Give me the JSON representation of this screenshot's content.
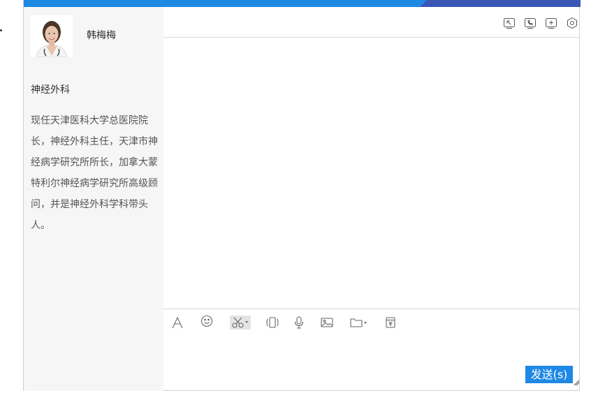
{
  "doctor": {
    "name": "韩梅梅",
    "department": "神经外科",
    "bio": "现任天津医科大学总医院院长，神经外科主任，天津市神经病学研究所所长，加拿大蒙特利尔神经病学研究所高级顾问，并是神经外科学科带头人。"
  },
  "chat": {
    "send_label": "发送(s)"
  },
  "icons": {
    "header": [
      "fullscreen-icon",
      "phone-icon",
      "add-icon",
      "settings-icon"
    ],
    "toolbar": [
      "font-icon",
      "emoji-icon",
      "screenshot-icon",
      "shake-icon",
      "voice-icon",
      "image-icon",
      "folder-icon",
      "gift-icon"
    ]
  },
  "colors": {
    "accent": "#1e88e5",
    "topbar_dark": "#3a57b5",
    "sidebar_bg": "#f6f6f6"
  }
}
